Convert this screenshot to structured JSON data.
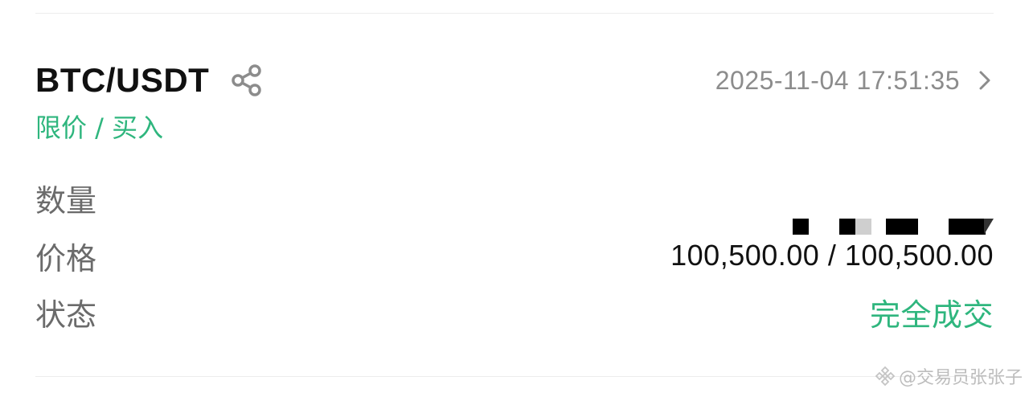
{
  "order": {
    "pair": "BTC/USDT",
    "datetime": "2025-11-04 17:51:35",
    "order_type": "限价 / 买入",
    "fields": {
      "quantity_label": "数量",
      "price_label": "价格",
      "price_value": "100,500.00 / 100,500.00",
      "status_label": "状态",
      "status_value": "完全成交"
    }
  },
  "icons": {
    "share": "share-icon",
    "chevron": "chevron-right-icon",
    "watermark_logo": "binance-logo-icon"
  },
  "watermark": {
    "text": "@交易员张张子"
  },
  "colors": {
    "accent_green": "#2fb67e",
    "text_primary": "#111111",
    "text_secondary": "#6b6b6b",
    "text_muted": "#8c8c8c",
    "divider": "#ececec"
  }
}
